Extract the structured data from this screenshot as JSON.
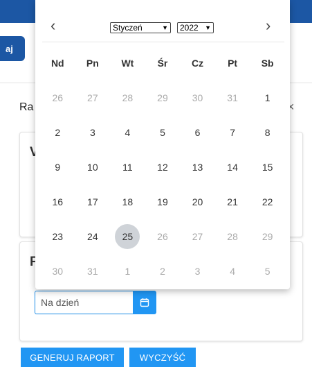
{
  "page": {
    "back_label": "aj",
    "modal_title": "Ra",
    "close_glyph": "×",
    "card1_heading": "V",
    "card2_heading": "F",
    "date_placeholder": "Na dzień",
    "generate_label": "GENERUJ RAPORT",
    "clear_label": "WYCZYŚĆ"
  },
  "picker": {
    "prev_glyph": "‹",
    "next_glyph": "›",
    "month": "Styczeń",
    "year": "2022",
    "weekdays": [
      "Nd",
      "Pn",
      "Wt",
      "Śr",
      "Cz",
      "Pt",
      "Sb"
    ],
    "weeks": [
      [
        {
          "d": "26",
          "m": true
        },
        {
          "d": "27",
          "m": true
        },
        {
          "d": "28",
          "m": true
        },
        {
          "d": "29",
          "m": true
        },
        {
          "d": "30",
          "m": true
        },
        {
          "d": "31",
          "m": true
        },
        {
          "d": "1",
          "m": false
        }
      ],
      [
        {
          "d": "2",
          "m": false
        },
        {
          "d": "3",
          "m": false
        },
        {
          "d": "4",
          "m": false
        },
        {
          "d": "5",
          "m": false
        },
        {
          "d": "6",
          "m": false
        },
        {
          "d": "7",
          "m": false
        },
        {
          "d": "8",
          "m": false
        }
      ],
      [
        {
          "d": "9",
          "m": false
        },
        {
          "d": "10",
          "m": false
        },
        {
          "d": "11",
          "m": false
        },
        {
          "d": "12",
          "m": false
        },
        {
          "d": "13",
          "m": false
        },
        {
          "d": "14",
          "m": false
        },
        {
          "d": "15",
          "m": false
        }
      ],
      [
        {
          "d": "16",
          "m": false
        },
        {
          "d": "17",
          "m": false
        },
        {
          "d": "18",
          "m": false
        },
        {
          "d": "19",
          "m": false
        },
        {
          "d": "20",
          "m": false
        },
        {
          "d": "21",
          "m": false
        },
        {
          "d": "22",
          "m": false
        }
      ],
      [
        {
          "d": "23",
          "m": false
        },
        {
          "d": "24",
          "m": false
        },
        {
          "d": "25",
          "m": false,
          "today": true
        },
        {
          "d": "26",
          "m": true
        },
        {
          "d": "27",
          "m": true
        },
        {
          "d": "28",
          "m": true
        },
        {
          "d": "29",
          "m": true
        }
      ],
      [
        {
          "d": "30",
          "m": true
        },
        {
          "d": "31",
          "m": true
        },
        {
          "d": "1",
          "m": true
        },
        {
          "d": "2",
          "m": true
        },
        {
          "d": "3",
          "m": true
        },
        {
          "d": "4",
          "m": true
        },
        {
          "d": "5",
          "m": true
        }
      ]
    ]
  },
  "colors": {
    "brand": "#1c57a4",
    "accent": "#2196f3",
    "today_bg": "#cfd3d8"
  }
}
